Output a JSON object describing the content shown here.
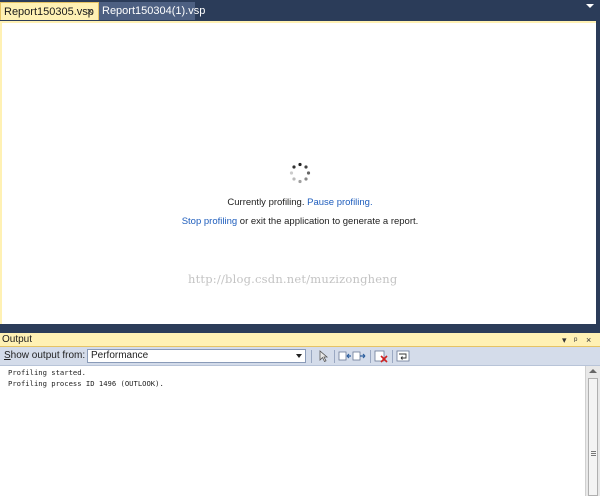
{
  "tabs": [
    {
      "label": "Report150305.vsp",
      "active": true,
      "close_glyph": "×"
    },
    {
      "label": "Report150304(1).vsp",
      "active": false
    }
  ],
  "document": {
    "spinner_icon": "busy-spinner-icon",
    "status_text": "Currently profiling.",
    "pause_link": "Pause profiling.",
    "stop_link": "Stop profiling",
    "stop_suffix": "or exit the application to generate a report.",
    "watermark": "http://blog.csdn.net/muzizongheng"
  },
  "output_panel": {
    "title": "Output",
    "title_buttons": [
      "▾",
      "ᵖ",
      "×"
    ],
    "show_output_from_label": "Show output from:",
    "show_output_from_accesskey": "S",
    "source_selected": "Performance",
    "toolbar_icons": [
      "go-to-location-icon",
      "previous-message-icon",
      "next-message-icon",
      "clear-all-icon",
      "toggle-word-wrap-icon"
    ],
    "lines": [
      "Profiling started.",
      "Profiling process ID 1496 (OUTLOOK)."
    ]
  },
  "colors": {
    "chrome": "#2b3c59",
    "active_tab": "#fff1b4",
    "inactive_tab": "#4d6082",
    "link": "#1f5ebd",
    "toolbar": "#d4dcea"
  }
}
